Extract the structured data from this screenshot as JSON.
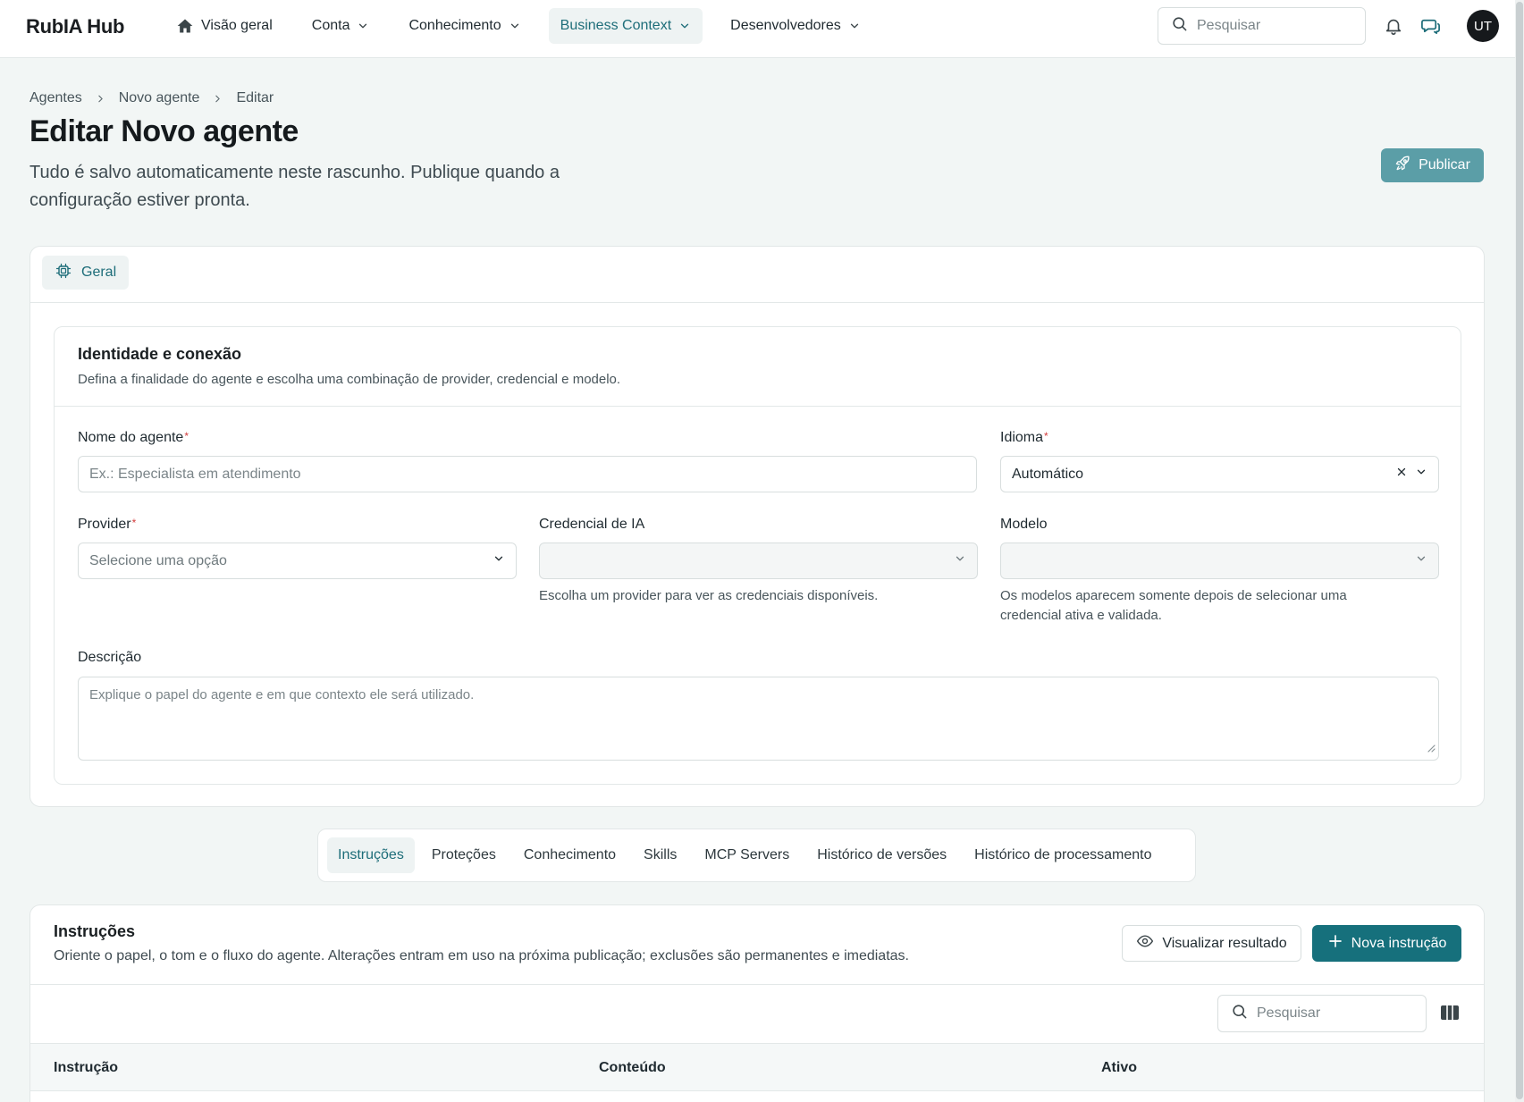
{
  "brand": "RubIA Hub",
  "nav": {
    "items": [
      {
        "label": "Visão geral",
        "icon": "home-icon",
        "dropdown": false,
        "active": false
      },
      {
        "label": "Conta",
        "dropdown": true,
        "active": false
      },
      {
        "label": "Conhecimento",
        "dropdown": true,
        "active": false
      },
      {
        "label": "Business Context",
        "dropdown": true,
        "active": true
      },
      {
        "label": "Desenvolvedores",
        "dropdown": true,
        "active": false
      }
    ],
    "search_placeholder": "Pesquisar",
    "avatar_initials": "UT"
  },
  "breadcrumb": [
    "Agentes",
    "Novo agente",
    "Editar"
  ],
  "page": {
    "title": "Editar Novo agente",
    "subtitle": "Tudo é salvo automaticamente neste rascunho. Publique quando a configuração estiver pronta.",
    "publish_label": "Publicar"
  },
  "main_tabs": [
    {
      "label": "Geral",
      "icon": "chip-icon",
      "active": true
    }
  ],
  "identity": {
    "title": "Identidade e conexão",
    "subtitle": "Defina a finalidade do agente e escolha uma combinação de provider, credencial e modelo.",
    "name_label": "Nome do agente",
    "name_placeholder": "Ex.: Especialista em atendimento",
    "name_value": "",
    "language_label": "Idioma",
    "language_value": "Automático",
    "provider_label": "Provider",
    "provider_placeholder": "Selecione uma opção",
    "credential_label": "Credencial de IA",
    "credential_value": "",
    "credential_hint": "Escolha um provider para ver as credenciais disponíveis.",
    "model_label": "Modelo",
    "model_value": "",
    "model_hint": "Os modelos aparecem somente depois de selecionar uma credencial ativa e validada.",
    "description_label": "Descrição",
    "description_placeholder": "Explique o papel do agente e em que contexto ele será utilizado.",
    "description_value": "",
    "required_mark": "*"
  },
  "lower_tabs": [
    {
      "label": "Instruções",
      "active": true
    },
    {
      "label": "Proteções",
      "active": false
    },
    {
      "label": "Conhecimento",
      "active": false
    },
    {
      "label": "Skills",
      "active": false
    },
    {
      "label": "MCP Servers",
      "active": false
    },
    {
      "label": "Histórico de versões",
      "active": false
    },
    {
      "label": "Histórico de processamento",
      "active": false
    }
  ],
  "instructions": {
    "title": "Instruções",
    "subtitle": "Oriente o papel, o tom e o fluxo do agente. Alterações entram em uso na próxima publicação; exclusões são permanentes e imediatas.",
    "preview_label": "Visualizar resultado",
    "new_label": "Nova instrução",
    "search_placeholder": "Pesquisar",
    "columns": [
      "Instrução",
      "Conteúdo",
      "Ativo"
    ]
  },
  "colors": {
    "accent": "#16707c",
    "accent_light": "#5b9ea7",
    "active_tab_bg": "#eef3f3",
    "page_bg": "#f2f6f5",
    "required": "#d23c3c"
  }
}
